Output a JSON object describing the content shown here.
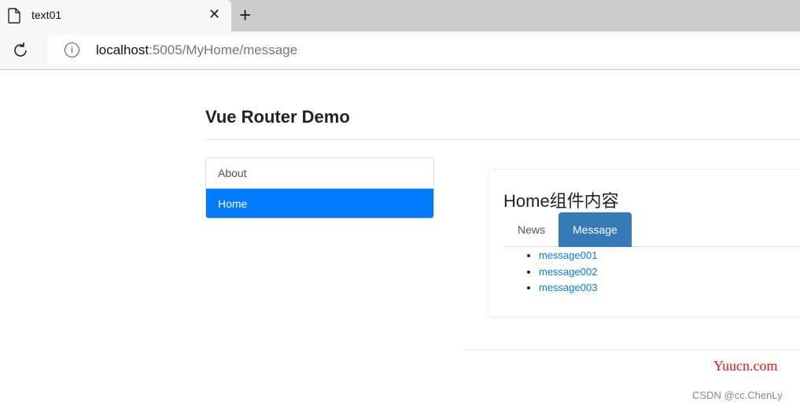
{
  "browser": {
    "tab_title": "text01",
    "url_host": "localhost",
    "url_rest": ":5005/MyHome/message"
  },
  "page": {
    "title": "Vue Router Demo",
    "nav": [
      {
        "label": "About",
        "active": false
      },
      {
        "label": "Home",
        "active": true
      }
    ],
    "home": {
      "heading": "Home组件内容",
      "tabs": [
        {
          "label": "News"
        },
        {
          "label": "Message",
          "active": true
        }
      ],
      "messages": [
        "message001",
        "message002",
        "message003"
      ]
    }
  },
  "watermarks": {
    "site": "Yuucn.com",
    "author": "CSDN @cc.ChenLy"
  },
  "colors": {
    "primary": "#007bff",
    "tab_active": "#337ab7"
  }
}
